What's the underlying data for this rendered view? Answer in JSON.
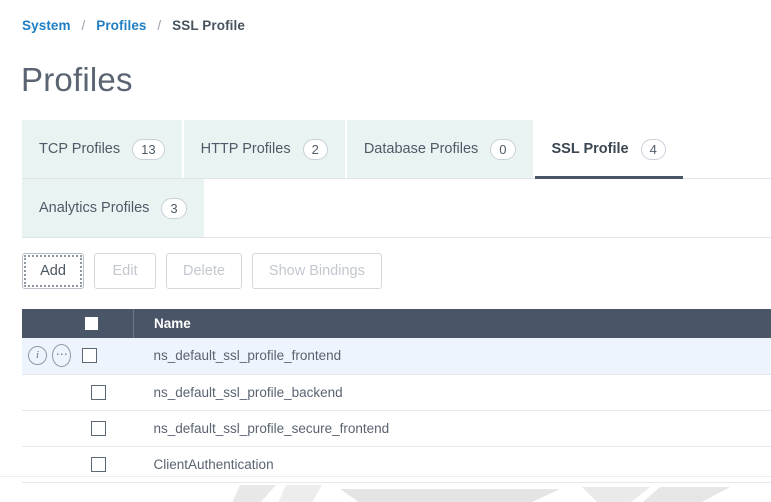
{
  "breadcrumb": {
    "items": [
      {
        "label": "System",
        "link": true
      },
      {
        "label": "Profiles",
        "link": true
      },
      {
        "label": "SSL Profile",
        "link": false
      }
    ],
    "separator": "/"
  },
  "page": {
    "title": "Profiles"
  },
  "tabs": {
    "row1": [
      {
        "label": "TCP Profiles",
        "count": "13",
        "active": false
      },
      {
        "label": "HTTP Profiles",
        "count": "2",
        "active": false
      },
      {
        "label": "Database Profiles",
        "count": "0",
        "active": false
      },
      {
        "label": "SSL Profile",
        "count": "4",
        "active": true
      }
    ],
    "row2": [
      {
        "label": "Analytics Profiles",
        "count": "3",
        "active": false
      }
    ]
  },
  "toolbar": {
    "add_label": "Add",
    "edit_label": "Edit",
    "delete_label": "Delete",
    "show_bindings_label": "Show Bindings"
  },
  "table": {
    "columns": [
      "",
      "Name"
    ],
    "rows": [
      {
        "name": "ns_default_ssl_profile_frontend",
        "selected": true,
        "checked": false
      },
      {
        "name": "ns_default_ssl_profile_backend",
        "selected": false,
        "checked": false
      },
      {
        "name": "ns_default_ssl_profile_secure_frontend",
        "selected": false,
        "checked": false
      },
      {
        "name": "ClientAuthentication",
        "selected": false,
        "checked": false
      }
    ],
    "icons": {
      "info": "i",
      "more": "⋯"
    }
  },
  "colors": {
    "link": "#1f7ec4",
    "tab_inactive_bg": "#e9f3f2",
    "table_header_bg": "#4b5568",
    "row_selected_bg": "#eef4fb",
    "title_text": "#5b6472"
  }
}
